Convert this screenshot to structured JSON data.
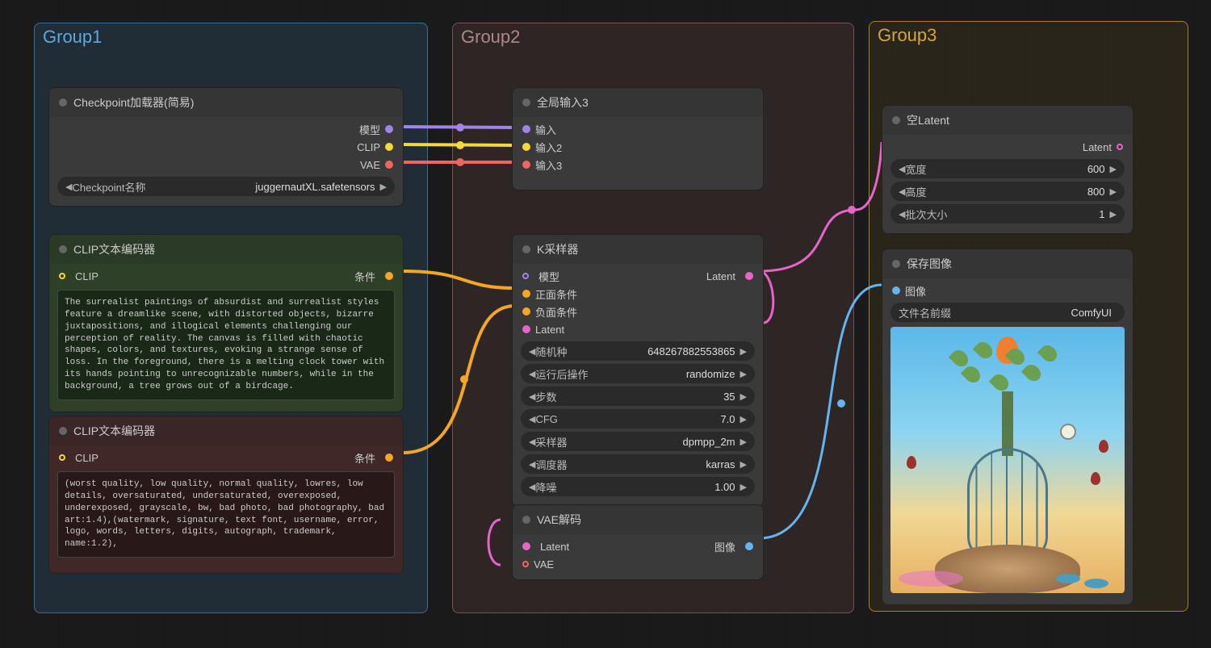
{
  "groups": {
    "g1": "Group1",
    "g2": "Group2",
    "g3": "Group3"
  },
  "nodes": {
    "checkpoint": {
      "title": "Checkpoint加载器(简易)",
      "outputs": {
        "model": "模型",
        "clip": "CLIP",
        "vae": "VAE"
      },
      "widget_label": "Checkpoint名称",
      "widget_value": "juggernautXL.safetensors"
    },
    "clip_pos": {
      "title": "CLIP文本编码器",
      "input": "CLIP",
      "output": "条件",
      "text": "The surrealist paintings of absurdist and surrealist styles feature a dreamlike scene, with distorted objects, bizarre juxtapositions, and illogical elements challenging our perception of reality. The canvas is filled with chaotic shapes, colors, and textures, evoking a strange sense of loss. In the foreground, there is a melting clock tower with its hands pointing to unrecognizable numbers, while in the background, a tree grows out of a birdcage."
    },
    "clip_neg": {
      "title": "CLIP文本编码器",
      "input": "CLIP",
      "output": "条件",
      "text": "(worst quality, low quality, normal quality, lowres, low details, oversaturated, undersaturated, overexposed, underexposed, grayscale, bw, bad photo, bad photography, bad art:1.4),(watermark, signature, text font, username, error, logo, words, letters, digits, autograph, trademark, name:1.2),"
    },
    "global_in": {
      "title": "全局输入3",
      "inputs": {
        "i1": "输入",
        "i2": "输入2",
        "i3": "输入3"
      }
    },
    "ksampler": {
      "title": "K采样器",
      "inputs": {
        "model": "模型",
        "pos": "正面条件",
        "neg": "负面条件",
        "latent": "Latent"
      },
      "output": "Latent",
      "params": {
        "seed_label": "随机种",
        "seed_value": "648267882553865",
        "after_label": "运行后操作",
        "after_value": "randomize",
        "steps_label": "步数",
        "steps_value": "35",
        "cfg_label": "CFG",
        "cfg_value": "7.0",
        "sampler_label": "采样器",
        "sampler_value": "dpmpp_2m",
        "sched_label": "调度器",
        "sched_value": "karras",
        "denoise_label": "降噪",
        "denoise_value": "1.00"
      }
    },
    "vae_decode": {
      "title": "VAE解码",
      "inputs": {
        "latent": "Latent",
        "vae": "VAE"
      },
      "output": "图像"
    },
    "empty_latent": {
      "title": "空Latent",
      "output": "Latent",
      "params": {
        "width_label": "宽度",
        "width_value": "600",
        "height_label": "高度",
        "height_value": "800",
        "batch_label": "批次大小",
        "batch_value": "1"
      }
    },
    "save_image": {
      "title": "保存图像",
      "input": "图像",
      "prefix_label": "文件名前缀",
      "prefix_value": "ComfyUI"
    }
  }
}
